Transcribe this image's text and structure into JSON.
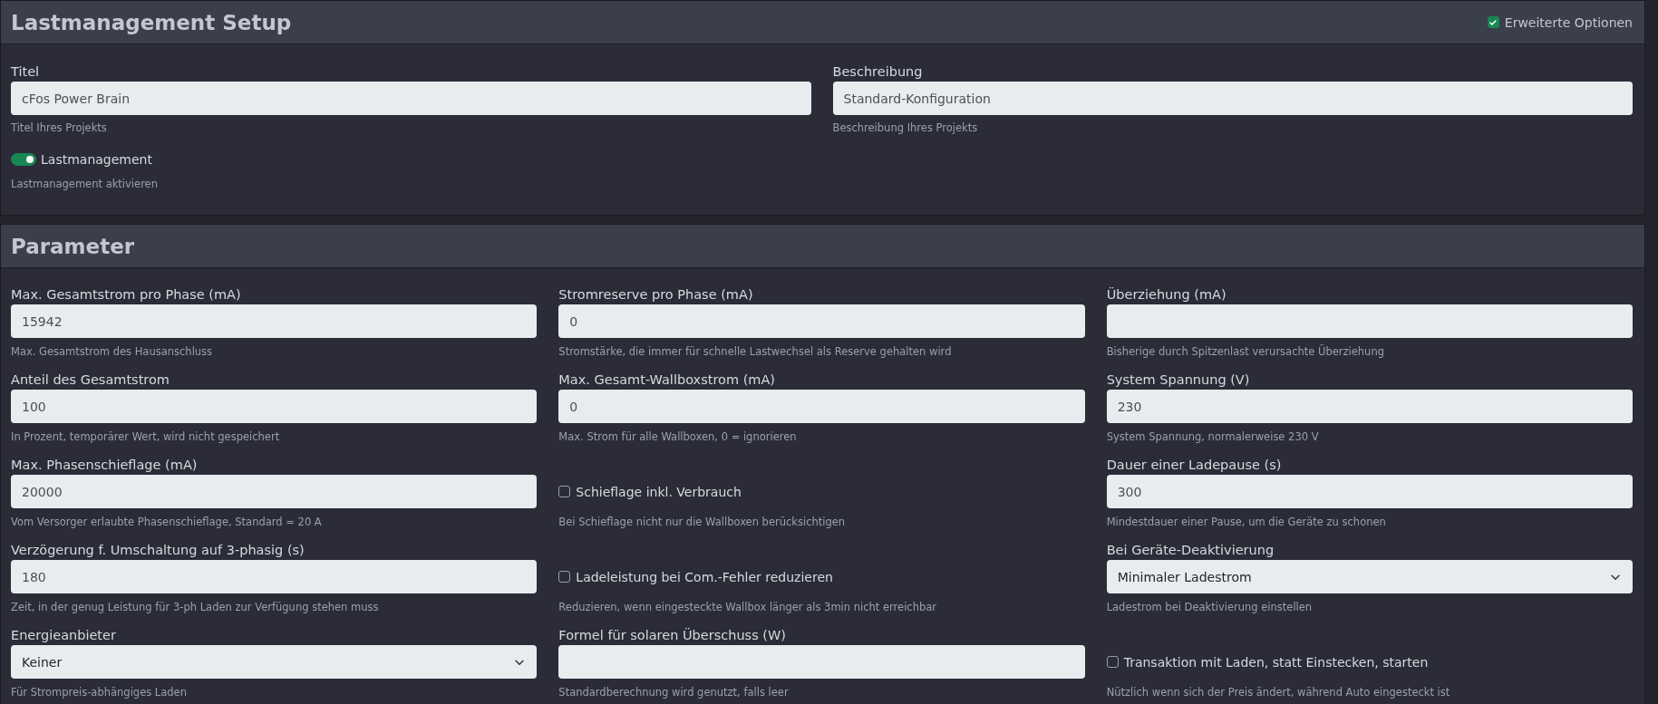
{
  "sections": [
    {
      "title": "Lastmanagement Setup",
      "header_option": {
        "label": "Erweiterte Optionen",
        "checked": true
      },
      "fields": [
        {
          "kind": "text",
          "label": "Titel",
          "value": "cFos Power Brain",
          "help": "Titel Ihres Projekts"
        },
        {
          "kind": "text",
          "label": "Beschreibung",
          "value": "Standard-Konfiguration",
          "help": "Beschreibung Ihres Projekts"
        },
        {
          "kind": "toggle",
          "label": "Lastmanagement",
          "on": true,
          "help": "Lastmanagement aktivieren"
        }
      ]
    },
    {
      "title": "Parameter",
      "fields": [
        {
          "kind": "text",
          "label": "Max. Gesamtstrom pro Phase (mA)",
          "value": "15942",
          "help": "Max. Gesamtstrom des Hausanschluss"
        },
        {
          "kind": "text",
          "label": "Stromreserve pro Phase (mA)",
          "value": "0",
          "help": "Stromstärke, die immer für schnelle Lastwechsel als Reserve gehalten wird"
        },
        {
          "kind": "text",
          "label": "Überziehung (mA)",
          "help": "Bisherige durch Spitzenlast verursachte Überziehung"
        },
        {
          "kind": "text",
          "label": "Anteil des Gesamtstrom",
          "value": "100",
          "help": "In Prozent, temporärer Wert, wird nicht gespeichert"
        },
        {
          "kind": "text",
          "label": "Max. Gesamt-Wallboxstrom (mA)",
          "value": "0",
          "help": "Max. Strom für alle Wallboxen, 0 = ignorieren"
        },
        {
          "kind": "text",
          "label": "System Spannung (V)",
          "value": "230",
          "help": "System Spannung, normalerweise 230 V"
        },
        {
          "kind": "text",
          "label": "Max. Phasenschieflage (mA)",
          "value": "20000",
          "help": "Vom Versorger erlaubte Phasenschieflage, Standard = 20 A"
        },
        {
          "kind": "checkbox",
          "label": "Schieflage inkl. Verbrauch",
          "checked": false,
          "help": "Bei Schieflage nicht nur die Wallboxen berücksichtigen"
        },
        {
          "kind": "text",
          "label": "Dauer einer Ladepause (s)",
          "value": "300",
          "help": "Mindestdauer einer Pause, um die Geräte zu schonen"
        },
        {
          "kind": "text",
          "label": "Verzögerung f. Umschaltung auf 3-phasig (s)",
          "value": "180",
          "help": "Zeit, in der genug Leistung für 3-ph Laden zur Verfügung stehen muss"
        },
        {
          "kind": "checkbox",
          "label": "Ladeleistung bei Com.-Fehler reduzieren",
          "checked": false,
          "help": "Reduzieren, wenn eingesteckte Wallbox länger als 3min nicht erreichbar"
        },
        {
          "kind": "select",
          "label": "Bei Geräte-Deaktivierung",
          "value": "Minimaler Ladestrom",
          "help": "Ladestrom bei Deaktivierung einstellen"
        },
        {
          "kind": "select",
          "label": "Energieanbieter",
          "value": "Keiner",
          "help": "Für Strompreis-abhängiges Laden"
        },
        {
          "kind": "text",
          "label": "Formel für solaren Überschuss (W)",
          "help": "Standardberechnung wird genutzt, falls leer"
        },
        {
          "kind": "checkbox",
          "label": "Transaktion mit Laden, statt Einstecken, starten",
          "checked": false,
          "help": "Nützlich wenn sich der Preis ändert, während Auto eingesteckt ist"
        }
      ]
    }
  ]
}
